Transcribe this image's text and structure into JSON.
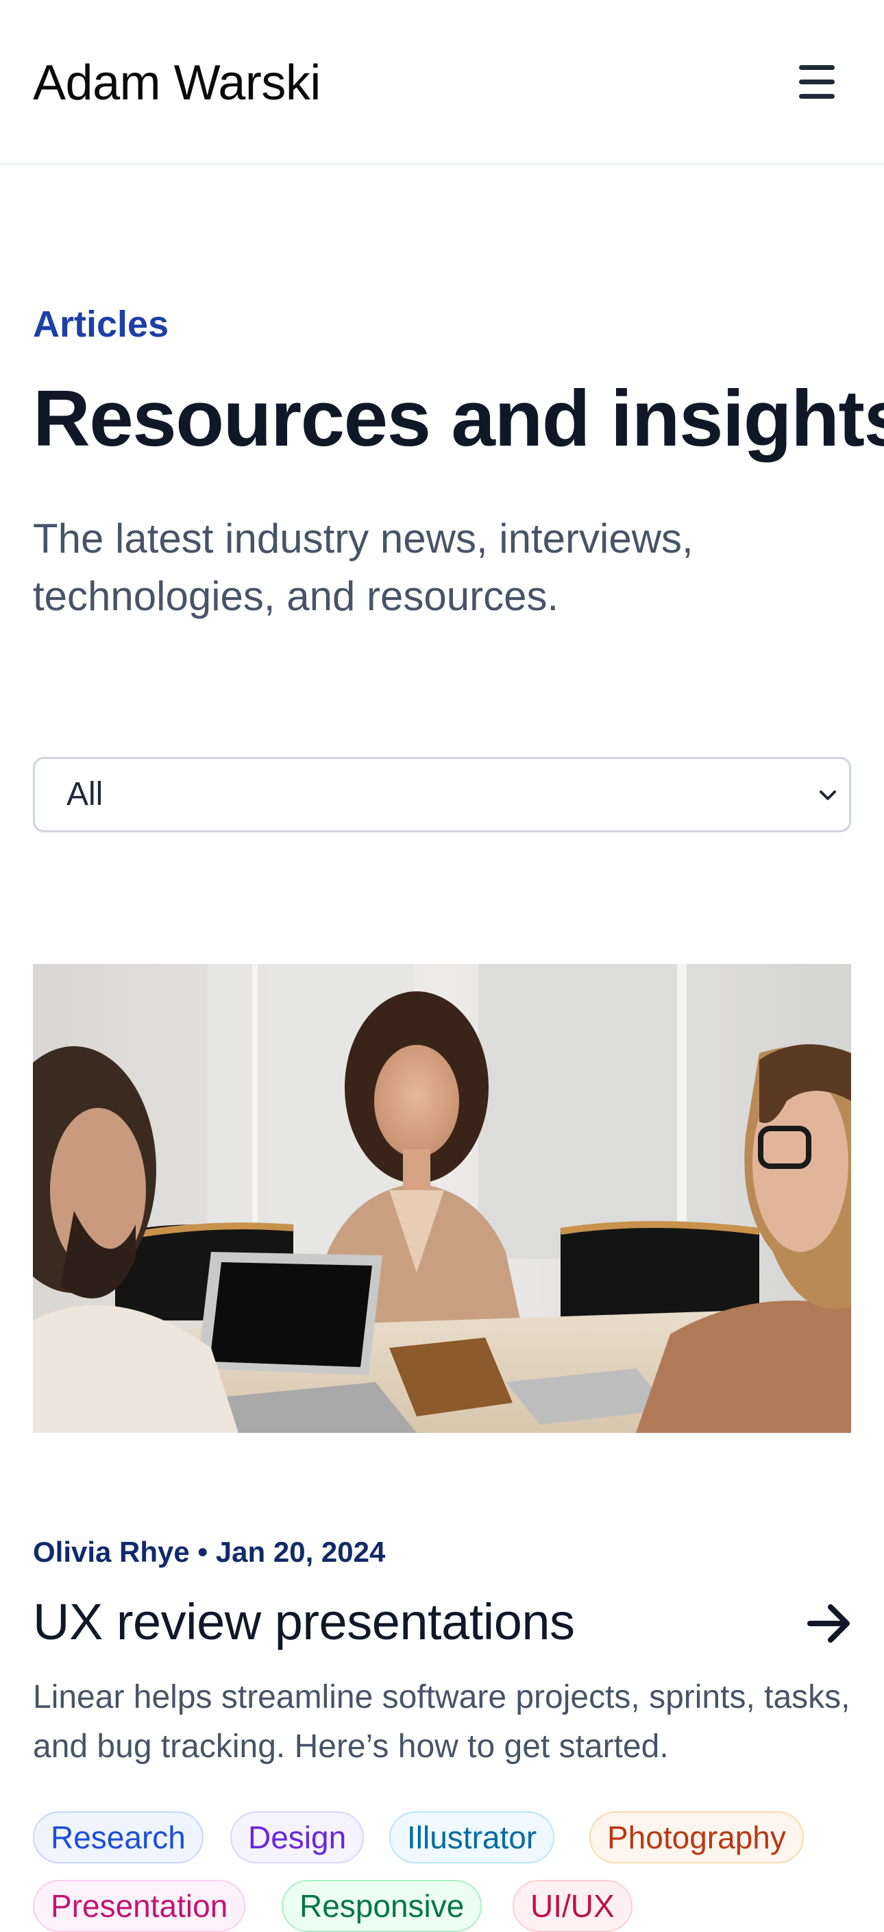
{
  "header": {
    "brand": "Adam Warski",
    "menu_icon": "hamburger-menu-icon"
  },
  "intro": {
    "eyebrow": "Articles",
    "title": "Resources and insights",
    "subtitle": "The latest industry news, interviews, technologies, and resources."
  },
  "filter": {
    "selected": "All",
    "chevron_icon": "chevron-down-icon"
  },
  "post": {
    "meta": "Olivia Rhye • Jan 20, 2024",
    "title": "UX review presentations",
    "excerpt": "Linear helps streamline software projects, sprints, tasks, and bug tracking. Here’s how to get started.",
    "arrow_icon": "arrow-right-icon",
    "tags": [
      {
        "label": "Research",
        "text": "#1d4ed8",
        "bg": "#eff4ff",
        "border": "#c7d7fe"
      },
      {
        "label": "Design",
        "text": "#6927da",
        "bg": "#f4f3ff",
        "border": "#d9d6fe"
      },
      {
        "label": "Illustrator",
        "text": "#026aa2",
        "bg": "#f0f9ff",
        "border": "#b9e6fe"
      },
      {
        "label": "Photography",
        "text": "#b93815",
        "bg": "#fef6ee",
        "border": "#f9dbaf"
      },
      {
        "label": "Presentation",
        "text": "#c11574",
        "bg": "#fdf2fa",
        "border": "#fcceee"
      },
      {
        "label": "Responsive",
        "text": "#067647",
        "bg": "#ecfdf3",
        "border": "#abefc6"
      },
      {
        "label": "UI/UX",
        "text": "#c01048",
        "bg": "#fff1f3",
        "border": "#fecdd6"
      }
    ]
  },
  "colors": {
    "accent": "#1d3fa6",
    "heading": "#101828",
    "body_text": "#475467",
    "divider": "#eef0f3"
  }
}
